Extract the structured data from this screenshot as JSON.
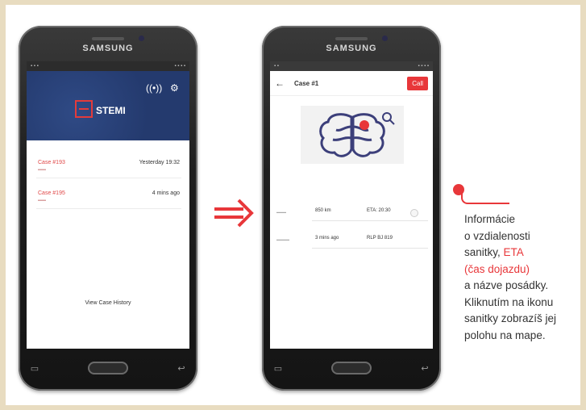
{
  "phone_left": {
    "brand": "SAMSUNG",
    "app_name": "STEMI",
    "cases": [
      {
        "id": "Case #193",
        "time": "Yesterday 19:32"
      },
      {
        "id": "Case #195",
        "time": "4 mins ago"
      }
    ],
    "history_link": "View Case History"
  },
  "phone_right": {
    "brand": "SAMSUNG",
    "title": "Case #1",
    "call_label": "Call",
    "rows": [
      {
        "left": "850 km",
        "right": "ETA: 20:30"
      },
      {
        "left": "3 mins ago",
        "right": "RLP BJ 819"
      }
    ]
  },
  "annotation": {
    "lines": [
      {
        "text": "Informácie",
        "highlight": false
      },
      {
        "text": "o vzdialenosti",
        "highlight": false
      },
      {
        "text": "sanitky, ",
        "highlight": false,
        "extra": "ETA"
      },
      {
        "text": "(čas dojazdu)",
        "highlight": true
      },
      {
        "text": "a názve posádky.",
        "highlight": false
      },
      {
        "text": "Kliknutím na ikonu",
        "highlight": false
      },
      {
        "text": "sanitky zobrazíš jej",
        "highlight": false
      },
      {
        "text": "polohu na mape.",
        "highlight": false
      }
    ]
  },
  "colors": {
    "accent": "#e8373a",
    "hero": "#243a6e"
  }
}
